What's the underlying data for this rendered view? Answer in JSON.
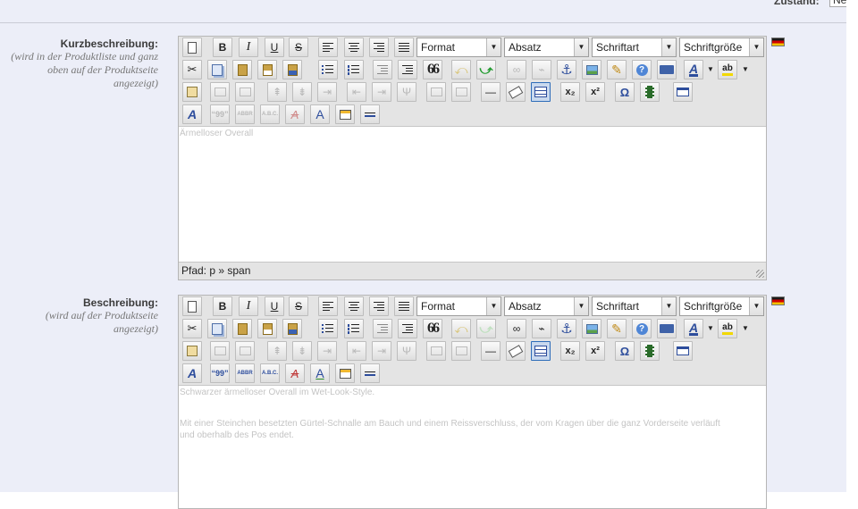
{
  "header": {
    "zustand_label": "Zustand:",
    "zustand_value": "Ne"
  },
  "fields": [
    {
      "label": "Kurzbeschreibung:",
      "hint_lines": [
        "(wird in der Produktliste und ganz",
        "oben auf der Produktseite",
        "angezeigt)"
      ],
      "format": "Format",
      "paragraph": "Absatz",
      "font": "Schriftart",
      "size": "Schriftgröße",
      "content_lines": [
        "Ärmelloser Overall"
      ],
      "status": "Pfad: p » span"
    },
    {
      "label": "Beschreibung:",
      "hint_lines": [
        "(wird auf der Produktseite",
        "angezeigt)"
      ],
      "format": "Format",
      "paragraph": "Absatz",
      "font": "Schriftart",
      "size": "Schriftgröße",
      "content_lines": [
        "Schwarzer ärmelloser Overall im Wet-Look-Style.",
        "Mit einer Steinchen besetzten Gürtel-Schnalle am Bauch und einem Reissverschluss, der vom Kragen über die ganz Vorderseite verläuft",
        "und oberhalb des Pos endet."
      ]
    }
  ],
  "toolbar": {
    "bold": "B",
    "italic": "I",
    "underline": "U",
    "strike": "S",
    "blockquote": "66",
    "hr": "—",
    "sub": "x₂",
    "sup": "x²",
    "omega": "Ω",
    "abbr": "ABBR",
    "acronym": "A.B.C.",
    "cite": "“99”"
  },
  "colors": {
    "background": "#eceef8",
    "toolbar": "#e4e4e4",
    "flag_black": "#1a1a1a",
    "flag_red": "#d00000",
    "flag_gold": "#f2c100"
  }
}
